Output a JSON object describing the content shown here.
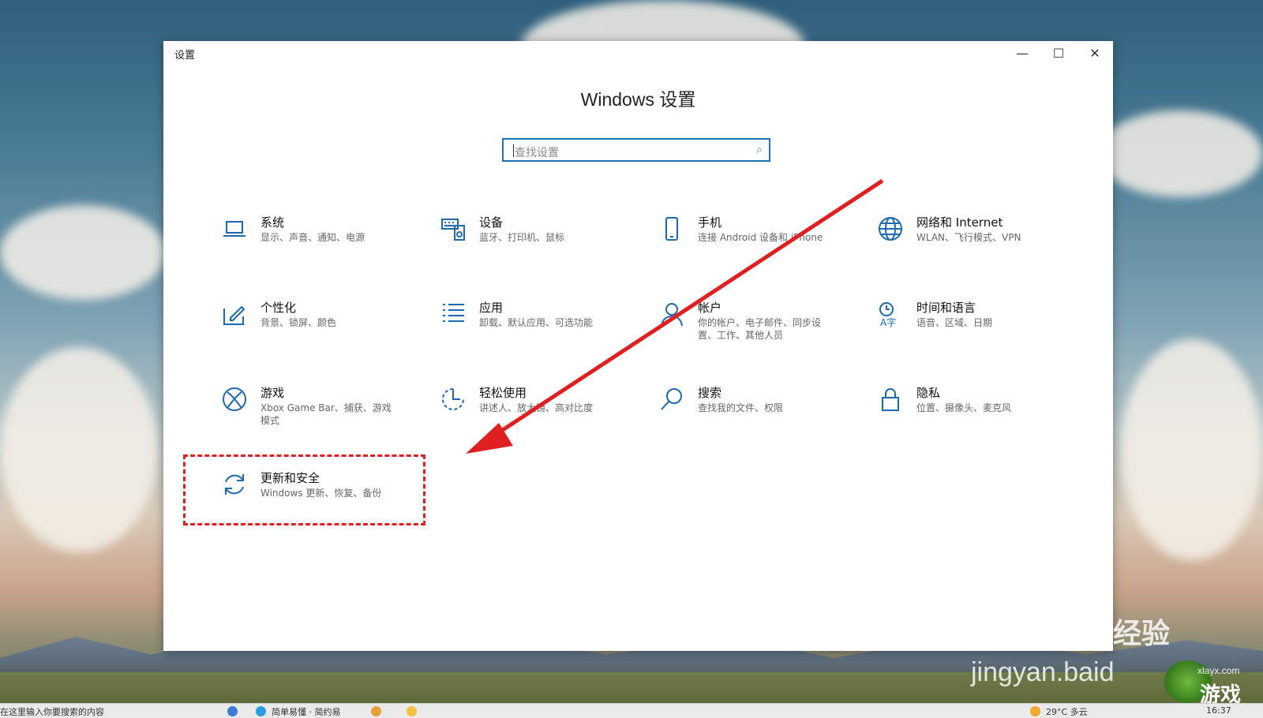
{
  "window": {
    "title": "设置",
    "controls": {
      "minimize": "—",
      "maximize": "☐",
      "close": "✕"
    }
  },
  "page": {
    "title": "Windows 设置"
  },
  "search": {
    "placeholder": "查找设置",
    "icon": "search-icon"
  },
  "categories": [
    {
      "name": "系统",
      "desc": "显示、声音、通知、电源",
      "icon": "laptop-icon"
    },
    {
      "name": "设备",
      "desc": "蓝牙、打印机、鼠标",
      "icon": "keyboard-speaker-icon"
    },
    {
      "name": "手机",
      "desc": "连接 Android 设备和 iPhone",
      "icon": "phone-icon"
    },
    {
      "name": "网络和 Internet",
      "desc": "WLAN、飞行模式、VPN",
      "icon": "globe-icon"
    },
    {
      "name": "个性化",
      "desc": "背景、锁屏、颜色",
      "icon": "paint-icon"
    },
    {
      "name": "应用",
      "desc": "卸载、默认应用、可选功能",
      "icon": "apps-list-icon"
    },
    {
      "name": "帐户",
      "desc": "你的帐户、电子邮件、同步设置、工作、其他人员",
      "icon": "person-icon"
    },
    {
      "name": "时间和语言",
      "desc": "语音、区域、日期",
      "icon": "time-language-icon"
    },
    {
      "name": "游戏",
      "desc": "Xbox Game Bar、捕获、游戏模式",
      "icon": "xbox-icon"
    },
    {
      "name": "轻松使用",
      "desc": "讲述人、放大镜、高对比度",
      "icon": "ease-of-access-icon"
    },
    {
      "name": "搜索",
      "desc": "查找我的文件、权限",
      "icon": "magnifier-icon"
    },
    {
      "name": "隐私",
      "desc": "位置、摄像头、麦克风",
      "icon": "lock-icon"
    },
    {
      "name": "更新和安全",
      "desc": "Windows 更新、恢复、备份",
      "icon": "sync-icon"
    }
  ],
  "annotation": {
    "highlight_color": "#e02020",
    "arrow_color": "#e02020"
  },
  "watermark": {
    "baidu": "Bai",
    "jingyan": "经验",
    "url": "jingyan.baid",
    "site": "xlayx.com",
    "game": "游戏"
  },
  "taskbar": {
    "search_text": "在这里输入你要搜索的内容",
    "app_label": "简单易懂 · 简约易",
    "weather": "29°C 多云",
    "time": "16:37"
  },
  "accent_color": "#1b6ab3"
}
